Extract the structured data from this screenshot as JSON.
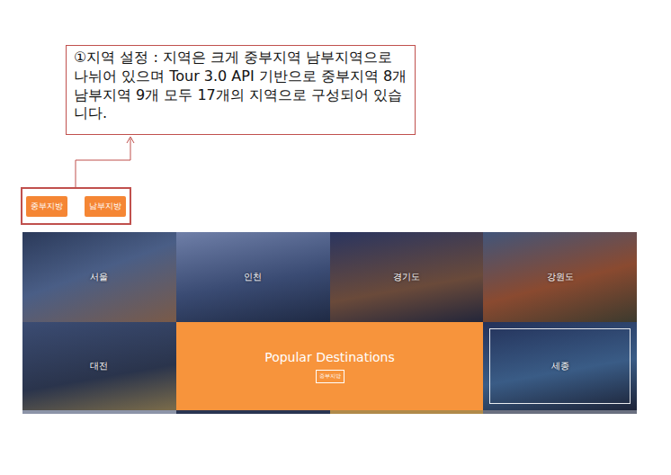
{
  "annotation": {
    "text": "①지역 설정 : 지역은 크게 중부지역 남부지역으로 나뉘어 있으며 Tour 3.0 API 기반으로 중부지역 8개 남부지역 9개 모두 17개의 지역으로 구성되어 있습니다."
  },
  "region_buttons": [
    {
      "label": "중부지방"
    },
    {
      "label": "남부지방"
    }
  ],
  "destinations": [
    {
      "name": "서울",
      "highlighted": false
    },
    {
      "name": "인천",
      "highlighted": false
    },
    {
      "name": "경기도",
      "highlighted": false
    },
    {
      "name": "강원도",
      "highlighted": false
    },
    {
      "name": "대전",
      "highlighted": false
    },
    {
      "name": "세종",
      "highlighted": true
    }
  ],
  "feature": {
    "title": "Popular Destinations",
    "button": "중부지방"
  }
}
